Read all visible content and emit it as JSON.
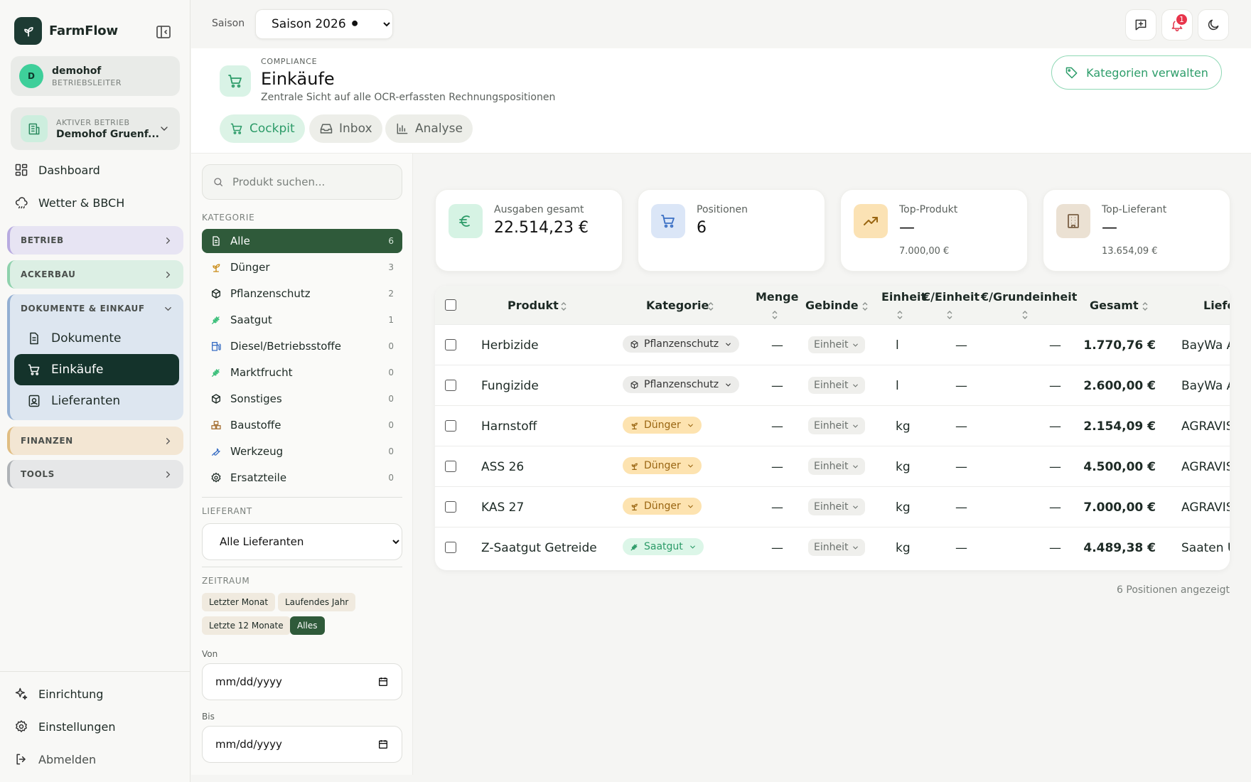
{
  "app": {
    "name": "FarmFlow"
  },
  "user": {
    "initial": "D",
    "name": "demohof",
    "role": "BETRIEBSLEITER"
  },
  "business": {
    "label": "AKTIVER BETRIEB",
    "name": "Demohof Gruenf..."
  },
  "nav": {
    "dashboard": "Dashboard",
    "weather": "Wetter & BBCH"
  },
  "groups": {
    "betrieb": "BETRIEB",
    "ackerbau": "ACKERBAU",
    "dokumente": "DOKUMENTE & EINKAUF",
    "finanzen": "FINANZEN",
    "tools": "TOOLS"
  },
  "docs_items": [
    "Dokumente",
    "Einkäufe",
    "Lieferanten"
  ],
  "footer_nav": {
    "setup": "Einrichtung",
    "settings": "Einstellungen",
    "logout": "Abmelden"
  },
  "topbar": {
    "season_label": "Saison",
    "season_value": "Saison 2026 ⚫",
    "notifications": "1"
  },
  "header": {
    "overline": "COMPLIANCE",
    "title": "Einkäufe",
    "subtitle": "Zentrale Sicht auf alle OCR-erfassten Rechnungspositionen",
    "manage_button": "Kategorien verwalten"
  },
  "tabs": [
    "Cockpit",
    "Inbox",
    "Analyse"
  ],
  "filters": {
    "search_placeholder": "Produkt suchen...",
    "category_label": "KATEGORIE",
    "categories": [
      {
        "name": "Alle",
        "count": "6"
      },
      {
        "name": "Dünger",
        "count": "3"
      },
      {
        "name": "Pflanzenschutz",
        "count": "2"
      },
      {
        "name": "Saatgut",
        "count": "1"
      },
      {
        "name": "Diesel/Betriebsstoffe",
        "count": "0"
      },
      {
        "name": "Marktfrucht",
        "count": "0"
      },
      {
        "name": "Sonstiges",
        "count": "0"
      },
      {
        "name": "Baustoffe",
        "count": "0"
      },
      {
        "name": "Werkzeug",
        "count": "0"
      },
      {
        "name": "Ersatzteile",
        "count": "0"
      }
    ],
    "supplier_label": "LIEFERANT",
    "supplier_value": "Alle Lieferanten",
    "period_label": "ZEITRAUM",
    "periods": [
      "Letzter Monat",
      "Laufendes Jahr",
      "Letzte 12 Monate",
      "Alles"
    ],
    "from_label": "Von",
    "to_label": "Bis",
    "date_placeholder": "mm/dd/yyyy"
  },
  "kpis": [
    {
      "label": "Ausgaben gesamt",
      "value": "22.514,23 €",
      "sub": ""
    },
    {
      "label": "Positionen",
      "value": "6",
      "sub": ""
    },
    {
      "label": "Top-Produkt",
      "value": "—",
      "sub": "7.000,00 €"
    },
    {
      "label": "Top-Lieferant",
      "value": "—",
      "sub": "13.654,09 €"
    }
  ],
  "table": {
    "headers": {
      "product": "Produkt",
      "category": "Kategorie",
      "amount": "Menge",
      "container": "Gebinde",
      "unit": "Einheit",
      "price_unit": "€/Einheit",
      "price_base": "€/Grundeinheit",
      "total": "Gesamt",
      "supplier": "Liefe"
    },
    "rows": [
      {
        "product": "Herbizide",
        "category": "Pflanzenschutz",
        "amount": "—",
        "container": "Einheit",
        "unit": "l",
        "price_unit": "—",
        "price_base": "—",
        "total": "1.770,76 €",
        "supplier": "BayWa A"
      },
      {
        "product": "Fungizide",
        "category": "Pflanzenschutz",
        "amount": "—",
        "container": "Einheit",
        "unit": "l",
        "price_unit": "—",
        "price_base": "—",
        "total": "2.600,00 €",
        "supplier": "BayWa A"
      },
      {
        "product": "Harnstoff",
        "category": "Dünger",
        "amount": "—",
        "container": "Einheit",
        "unit": "kg",
        "price_unit": "—",
        "price_base": "—",
        "total": "2.154,09 €",
        "supplier": "AGRAVIS"
      },
      {
        "product": "ASS 26",
        "category": "Dünger",
        "amount": "—",
        "container": "Einheit",
        "unit": "kg",
        "price_unit": "—",
        "price_base": "—",
        "total": "4.500,00 €",
        "supplier": "AGRAVIS"
      },
      {
        "product": "KAS 27",
        "category": "Dünger",
        "amount": "—",
        "container": "Einheit",
        "unit": "kg",
        "price_unit": "—",
        "price_base": "—",
        "total": "7.000,00 €",
        "supplier": "AGRAVIS"
      },
      {
        "product": "Z-Saatgut Getreide",
        "category": "Saatgut",
        "amount": "—",
        "container": "Einheit",
        "unit": "kg",
        "price_unit": "—",
        "price_base": "—",
        "total": "4.489,38 €",
        "supplier": "Saaten U"
      }
    ],
    "footer": "6 Positionen angezeigt"
  },
  "colors": {
    "brand_dark": "#14332b",
    "accent_green": "#2c9b68",
    "filter_active": "#2f5a3a",
    "pflanzenschutz_pill": "#ececea",
    "duenger_pill": "#fde3b0",
    "saatgut_pill": "#dcf6e8",
    "notification": "#e8344b"
  }
}
